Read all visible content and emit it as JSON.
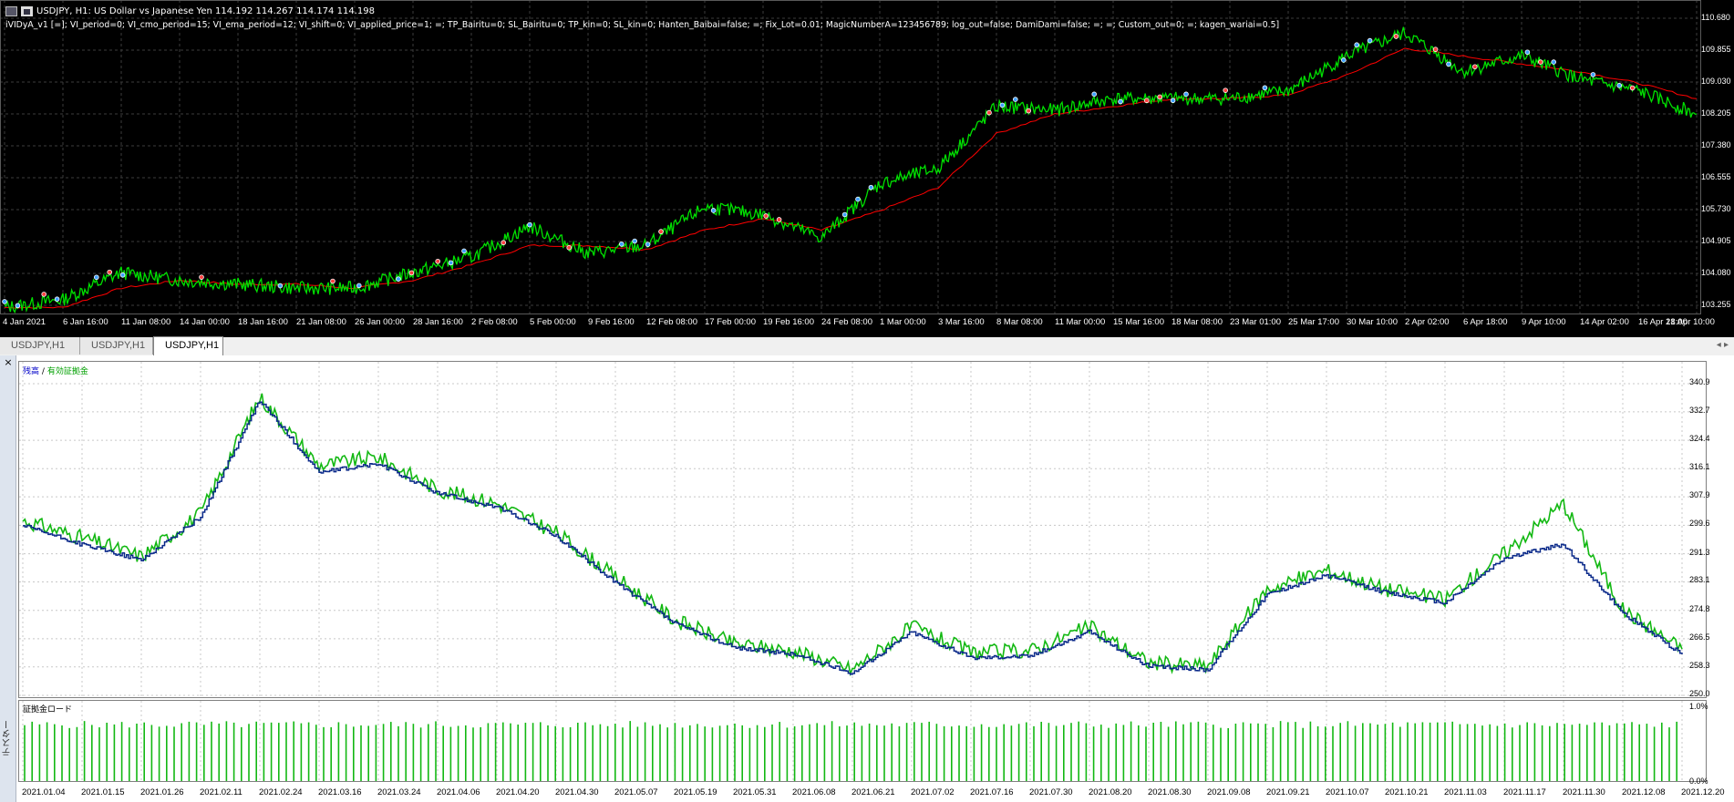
{
  "chart": {
    "symbol_line": "USDJPY, H1:  US Dollar vs Japanese Yen  114.192 114.267 114.174 114.198",
    "params": "iVIDyA_v1 [=]; VI_period=0; VI_cmo_period=15; VI_ema_period=12; VI_shift=0; VI_applied_price=1; =; TP_Bairitu=0; SL_Bairitu=0; TP_kin=0; SL_kin=0; Hanten_Baibai=false; =; Fix_Lot=0.01; MagicNumberA=123456789; log_out=false; DamiDami=false; =; =; Custom_out=0; =; kagen_wariai=0.5]",
    "price_ticks": [
      "110.680",
      "109.855",
      "109.030",
      "108.205",
      "107.380",
      "106.555",
      "105.730",
      "104.905",
      "104.080",
      "103.255"
    ],
    "time_ticks": [
      "4 Jan 2021",
      "6 Jan 16:00",
      "11 Jan 08:00",
      "14 Jan 00:00",
      "18 Jan 16:00",
      "21 Jan 08:00",
      "26 Jan 00:00",
      "28 Jan 16:00",
      "2 Feb 08:00",
      "5 Feb 00:00",
      "9 Feb 16:00",
      "12 Feb 08:00",
      "17 Feb 00:00",
      "19 Feb 16:00",
      "24 Feb 08:00",
      "1 Mar 00:00",
      "3 Mar 16:00",
      "8 Mar 08:00",
      "11 Mar 00:00",
      "15 Mar 16:00",
      "18 Mar 08:00",
      "23 Mar 01:00",
      "25 Mar 17:00",
      "30 Mar 10:00",
      "2 Apr 02:00",
      "6 Apr 18:00",
      "9 Apr 10:00",
      "14 Apr 02:00",
      "16 Apr 18:00",
      "21 Apr 10:00"
    ],
    "colors": {
      "background": "#000000",
      "price_line": "#00e000",
      "ma_line": "#ff0000",
      "grid": "#3c3c3c"
    }
  },
  "tabs": [
    "USDJPY,H1",
    "USDJPY,H1",
    "USDJPY,H1"
  ],
  "active_tab": 2,
  "tester": {
    "close": "×",
    "side_title": "テスター",
    "legend_balance": "残高",
    "legend_sep": "/",
    "legend_equity": "有効証拠金",
    "equity_ticks": [
      "340.9",
      "332.7",
      "324.4",
      "316.1",
      "307.9",
      "299.6",
      "291.3",
      "283.1",
      "274.8",
      "266.5",
      "258.3",
      "250.0"
    ],
    "load_title": "証拠金ロード",
    "load_ticks": [
      "1.0%",
      "0.0%"
    ],
    "date_ticks": [
      "2021.01.04",
      "2021.01.15",
      "2021.01.26",
      "2021.02.11",
      "2021.02.24",
      "2021.03.16",
      "2021.03.24",
      "2021.04.06",
      "2021.04.20",
      "2021.04.30",
      "2021.05.07",
      "2021.05.19",
      "2021.05.31",
      "2021.06.08",
      "2021.06.21",
      "2021.07.02",
      "2021.07.16",
      "2021.07.30",
      "2021.08.20",
      "2021.08.30",
      "2021.09.08",
      "2021.09.21",
      "2021.10.07",
      "2021.10.21",
      "2021.11.03",
      "2021.11.17",
      "2021.11.30",
      "2021.12.08",
      "2021.12.20"
    ],
    "colors": {
      "balance": "#0b2a8a",
      "equity": "#12b812",
      "load": "#12b812",
      "grid": "#c8c8c8"
    }
  },
  "chart_data": [
    {
      "type": "line",
      "x": [
        "4 Jan 2021",
        "6 Jan 16:00",
        "11 Jan 08:00",
        "14 Jan 00:00",
        "18 Jan 16:00",
        "21 Jan 08:00",
        "26 Jan 00:00",
        "28 Jan 16:00",
        "2 Feb 08:00",
        "5 Feb 00:00",
        "9 Feb 16:00",
        "12 Feb 08:00",
        "17 Feb 00:00",
        "19 Feb 16:00",
        "24 Feb 08:00",
        "1 Mar 00:00",
        "3 Mar 16:00",
        "8 Mar 08:00",
        "11 Mar 00:00",
        "15 Mar 16:00",
        "18 Mar 08:00",
        "23 Mar 01:00",
        "25 Mar 17:00",
        "30 Mar 10:00",
        "2 Apr 02:00",
        "6 Apr 18:00",
        "9 Apr 10:00",
        "14 Apr 02:00",
        "16 Apr 18:00",
        "21 Apr 10:00"
      ],
      "series": [
        {
          "values": [
            103.2,
            103.4,
            104.1,
            103.9,
            103.8,
            103.7,
            103.7,
            104.1,
            104.5,
            105.3,
            104.6,
            104.8,
            105.8,
            105.6,
            105.0,
            106.4,
            106.8,
            108.4,
            108.3,
            108.6,
            108.6,
            108.6,
            108.8,
            109.7,
            110.3,
            109.3,
            109.7,
            109.1,
            108.8,
            108.2
          ]
        },
        {
          "values": [
            103.2,
            103.2,
            103.7,
            103.9,
            103.8,
            103.8,
            103.7,
            103.9,
            104.3,
            104.8,
            104.8,
            104.7,
            105.2,
            105.5,
            105.2,
            105.7,
            106.3,
            107.7,
            108.2,
            108.4,
            108.6,
            108.6,
            108.7,
            109.2,
            109.9,
            109.7,
            109.5,
            109.3,
            109.0,
            108.6
          ]
        }
      ],
      "ylim": [
        103.255,
        110.68
      ],
      "grid": true
    },
    {
      "type": "line",
      "x": [
        "2021.01.04",
        "2021.01.15",
        "2021.01.26",
        "2021.02.11",
        "2021.02.24",
        "2021.03.16",
        "2021.03.24",
        "2021.04.06",
        "2021.04.20",
        "2021.04.30",
        "2021.05.07",
        "2021.05.19",
        "2021.05.31",
        "2021.06.08",
        "2021.06.21",
        "2021.07.02",
        "2021.07.16",
        "2021.07.30",
        "2021.08.20",
        "2021.08.30",
        "2021.09.08",
        "2021.09.21",
        "2021.10.07",
        "2021.10.21",
        "2021.11.03",
        "2021.11.17",
        "2021.11.30",
        "2021.12.08",
        "2021.12.20"
      ],
      "series": [
        {
          "name": "残高",
          "values": [
            299.5,
            294.0,
            289.5,
            302.0,
            336.0,
            315.0,
            317.5,
            309.0,
            305.0,
            296.5,
            283.0,
            271.0,
            264.0,
            262.0,
            256.5,
            268.5,
            261.0,
            261.5,
            268.5,
            258.5,
            257.5,
            279.5,
            285.0,
            280.0,
            277.0,
            290.0,
            294.0,
            274.0,
            262.0
          ]
        },
        {
          "name": "有効証拠金",
          "values": [
            301.0,
            296.0,
            290.5,
            303.0,
            337.0,
            317.0,
            319.5,
            310.0,
            306.0,
            297.5,
            284.5,
            272.0,
            265.0,
            263.0,
            257.5,
            270.0,
            262.5,
            263.0,
            270.0,
            259.5,
            258.5,
            281.0,
            286.5,
            281.0,
            278.0,
            291.5,
            306.0,
            275.0,
            263.5
          ]
        }
      ],
      "ylim": [
        250.0,
        340.9
      ],
      "grid": true
    }
  ]
}
